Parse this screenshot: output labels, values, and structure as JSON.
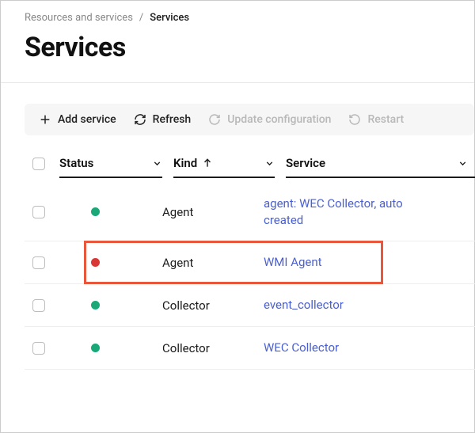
{
  "breadcrumb": {
    "parent": "Resources and services",
    "current": "Services"
  },
  "page_title": "Services",
  "toolbar": {
    "add_service": "Add service",
    "refresh": "Refresh",
    "update_config": "Update configuration",
    "restart": "Restart"
  },
  "columns": {
    "status": "Status",
    "kind": "Kind",
    "service": "Service"
  },
  "rows": [
    {
      "status": "green",
      "kind": "Agent",
      "service": "agent: WEC Collector, auto created"
    },
    {
      "status": "red",
      "kind": "Agent",
      "service": "WMI Agent"
    },
    {
      "status": "green",
      "kind": "Collector",
      "service": "event_collector"
    },
    {
      "status": "green",
      "kind": "Collector",
      "service": "WEC Collector"
    }
  ],
  "highlight_row_index": 1
}
